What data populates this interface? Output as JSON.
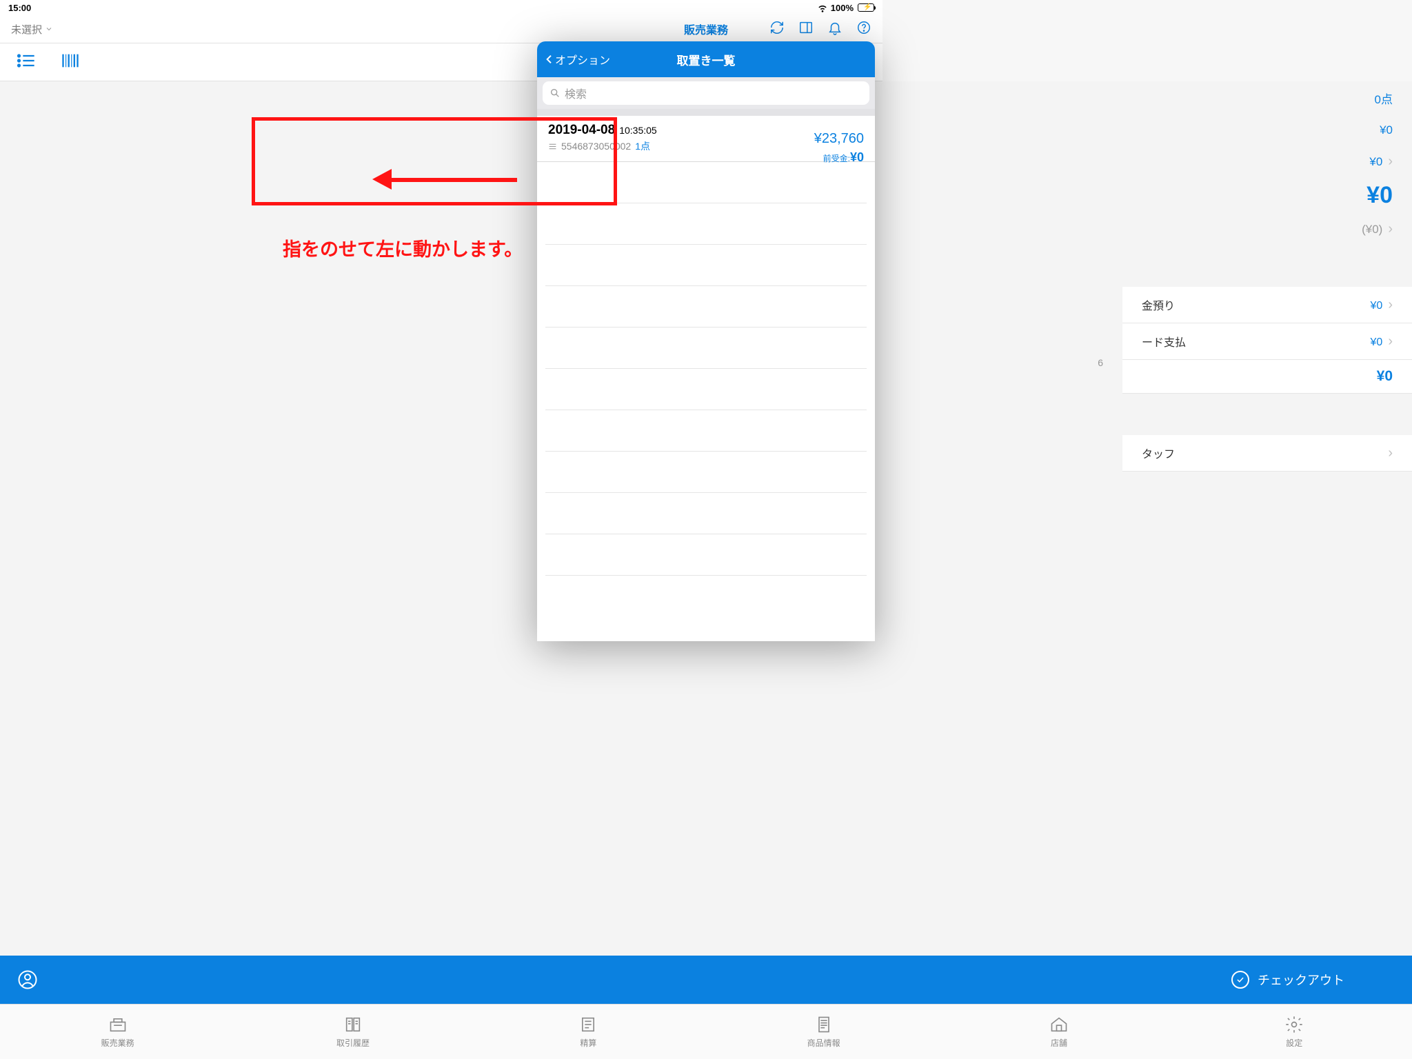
{
  "status": {
    "time": "15:00",
    "battery_pct": "100%"
  },
  "header": {
    "selector": "未選択",
    "title": "販売業務"
  },
  "summary": {
    "items_count": "0点",
    "line1": "¥0",
    "line2": "¥0",
    "total": "¥0",
    "paren": "(¥0)"
  },
  "payment": {
    "cash_label": "金預り",
    "cash_val": "¥0",
    "card_label": "ード支払",
    "card_val": "¥0",
    "total": "¥0"
  },
  "staff": {
    "label": "タッフ"
  },
  "trailing": "6",
  "checkout": "チェックアウト",
  "tabs": [
    "販売業務",
    "取引履歴",
    "精算",
    "商品情報",
    "店舗",
    "設定"
  ],
  "modal": {
    "back": "オプション",
    "title": "取置き一覧",
    "search_placeholder": "検索",
    "item": {
      "date": "2019-04-08",
      "time": "10:35:05",
      "code": "5546873050002",
      "count": "1点",
      "price": "¥23,760",
      "prepay_label": "前受金:",
      "prepay_val": "¥0"
    }
  },
  "instruction": "指をのせて左に動かします。"
}
